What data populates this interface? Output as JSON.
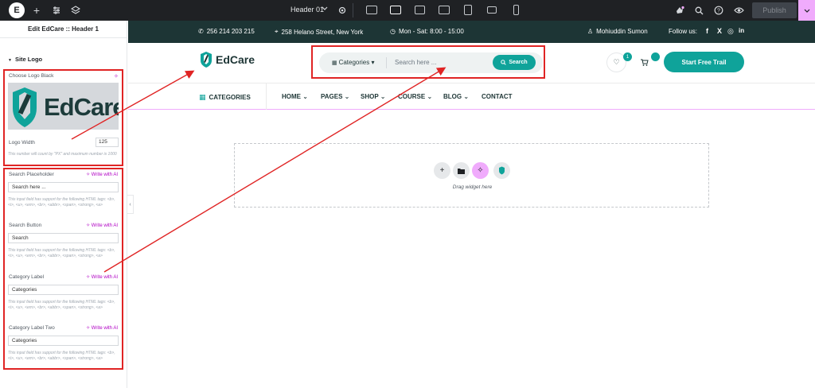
{
  "topbar": {
    "elementor_logo": "E",
    "add_icon": "+",
    "header_template": "Header 01",
    "publish_label": "Publish"
  },
  "panel": {
    "title": "Edit EdCare :: Header 1",
    "section_title": "Site Logo",
    "logo_label": "Choose Logo Black",
    "logo_preview_text": "EdCare",
    "logo_width_label": "Logo Width",
    "logo_width_value": "125",
    "logo_width_help": "This number will count by \"PX\" and maximum number is 1000",
    "write_ai": "Write with AI",
    "html_help": "This input field has support for the following HTML tags: <b>, <i>, <u>, <em>, <br>, <abbr>, <span>, <strong>, <a>",
    "search_placeholder_label": "Search Placeholder",
    "search_placeholder_value": "Search here ...",
    "search_button_label": "Search Button",
    "search_button_value": "Search",
    "category_label_label": "Category Label",
    "category_label_value": "Categories",
    "category_label_two_label": "Category Label Two",
    "category_label_two_value": "Categories"
  },
  "site": {
    "phone": "256 214 203 215",
    "address": "258 Helano Street, New York",
    "hours": "Mon - Sat: 8:00 - 15:00",
    "user": "Mohiuddin Sumon",
    "follow": "Follow us:",
    "logo_name": "EdCare",
    "search_category": "Categories",
    "search_placeholder": "Search here ...",
    "search_button": "Search",
    "wishlist_count": "1",
    "start_button": "Start Free Trail",
    "nav_categories": "CATEGORIES",
    "nav_items": [
      "HOME",
      "PAGES",
      "SHOP",
      "COURSE",
      "BLOG",
      "CONTACT"
    ],
    "drag_text": "Drag widget here"
  },
  "colors": {
    "accent": "#0fa39a",
    "dark_teal": "#1d3535",
    "annotation_red": "#e02424",
    "ai_purple": "#b000c4",
    "editor_dark": "#1f2124"
  }
}
